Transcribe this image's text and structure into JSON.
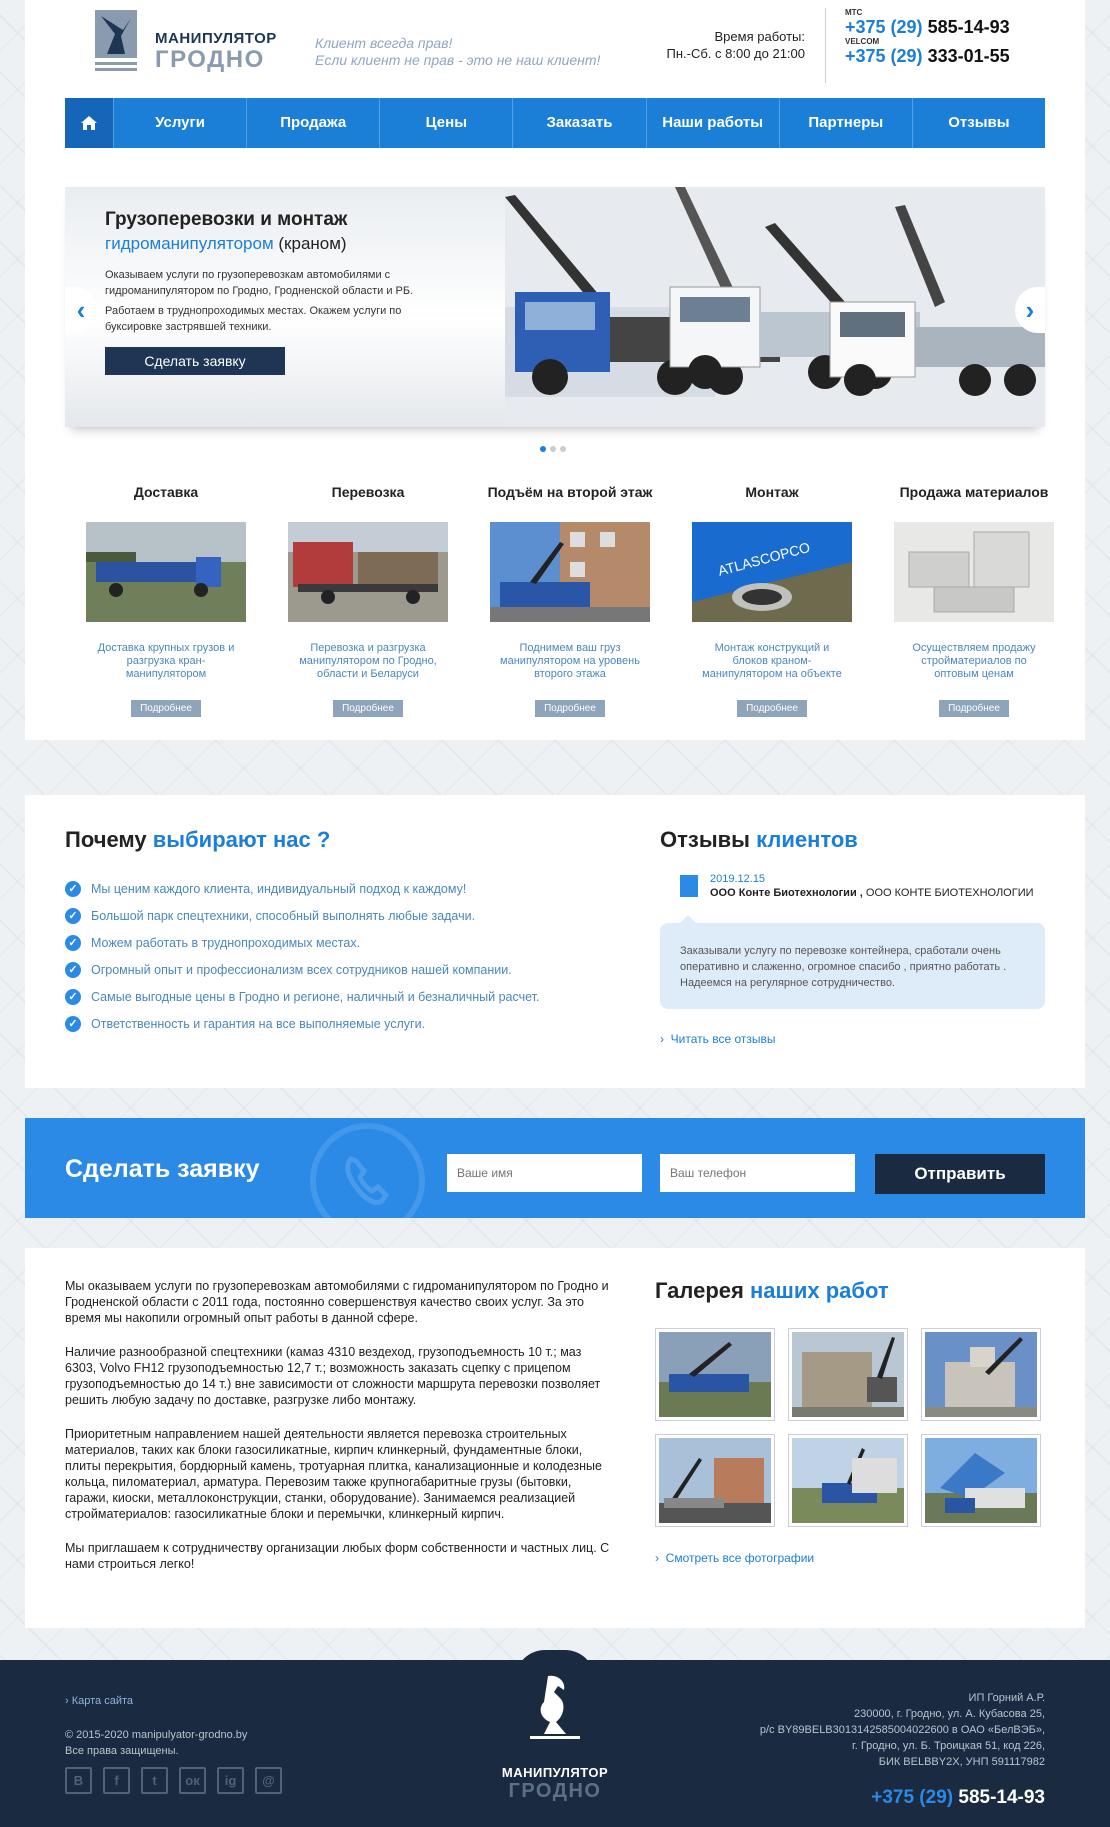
{
  "header": {
    "logo": {
      "line1": "МАНИПУЛЯТОР",
      "line2": "ГРОДНО"
    },
    "slogan": [
      "Клиент всегда прав!",
      "Если клиент не прав - это не наш клиент!"
    ],
    "worktime": {
      "label": "Время работы:",
      "hours": "Пн.-Сб. с 8:00 до 21:00"
    },
    "phones": [
      {
        "operator": "МТС",
        "code": "+375 (29)",
        "number": "585-14-93"
      },
      {
        "operator": "VELCOM",
        "code": "+375 (29)",
        "number": "333-01-55"
      }
    ]
  },
  "nav": {
    "home_icon": "home-icon",
    "items": [
      "Услуги",
      "Продажа",
      "Цены",
      "Заказать",
      "Наши работы",
      "Партнеры",
      "Отзывы"
    ]
  },
  "slider": {
    "title": "Грузоперевозки и монтаж",
    "subtitle_highlight": "гидроманипулятором",
    "subtitle_rest": "(краном)",
    "paragraph1": "Оказываем услуги по грузоперевозкам автомобилями с гидроманипулятором по Гродно, Гродненской области и РБ.",
    "paragraph2": "Работаем в труднопроходимых местах. Окажем услуги по буксировке застрявшей техники.",
    "button": "Сделать заявку",
    "prev": "‹",
    "next": "›",
    "slides_total": 3,
    "slide_active": 1
  },
  "services": [
    {
      "title": "Доставка",
      "desc": "Доставка крупных грузов и разгрузка кран-манипулятором",
      "button": "Подробнее"
    },
    {
      "title": "Перевозка",
      "desc": "Перевозка и разгрузка манипулятором по Гродно, области и Беларуси",
      "button": "Подробнее"
    },
    {
      "title": "Подъём на второй этаж",
      "desc": "Поднимем ваш груз манипулятором на уровень второго этажа",
      "button": "Подробнее"
    },
    {
      "title": "Монтаж",
      "desc": "Монтаж конструкций и блоков краном-манипулятором на объекте",
      "button": "Подробнее"
    },
    {
      "title": "Продажа материалов",
      "desc": "Осуществляем продажу стройматериалов по оптовым ценам",
      "button": "Подробнее"
    }
  ],
  "why": {
    "title_plain": "Почему",
    "title_blue": "выбирают нас ?",
    "items": [
      "Мы ценим каждого клиента, индивидуальный подход к каждому!",
      "Большой парк спецтехники, способный выполнять любые задачи.",
      "Можем работать в труднопроходимых местах.",
      "Огромный опыт и профессионализм всех сотрудников нашей компании.",
      "Самые выгодные цены в Гродно и регионе, наличный и безналичный расчет.",
      "Ответственность и гарантия на все выполняемые услуги."
    ]
  },
  "reviews": {
    "title_plain": "Отзывы",
    "title_blue": "клиентов",
    "date": "2019.12.15",
    "author_bold": "ООО Конте Биотехнологии ,",
    "author_rest": "ООО КОНТЕ БИОТЕХНОЛОГИИ",
    "text": "Заказывали услугу по перевозке контейнера, сработали очень оперативно и слаженно, огромное спасибо , приятно работать . Надеемся на регулярное сотрудничество.",
    "link": "Читать все отзывы"
  },
  "request": {
    "title": "Сделать заявку",
    "name_placeholder": "Ваше имя",
    "phone_placeholder": "Ваш телефон",
    "button": "Отправить"
  },
  "about": [
    "Мы оказываем  услуги по грузоперевозкам автомобилями с гидроманипулятором по Гродно и Гродненской области с 2011 года, постоянно совершенствуя качество своих услуг. За это время мы накопили огромный опыт работы в данной сфере.",
    "Наличие разнообразной спецтехники (камаз 4310 вездеход, грузоподъемность 10 т.; маз 6303, Volvo FH12 грузоподъемностью 12,7 т.; возможность заказать сцепку с прицепом грузоподъемностью до 14 т.) вне зависимости от сложности маршрута перевозки позволяет решить любую задачу по доставке, разгрузке либо монтажу.",
    "Приоритетным направлением нашей деятельности является перевозка строительных материалов, таких как блоки газосиликатные, кирпич клинкерный, фундаментные блоки, плиты перекрытия, бордюрный камень, тротуарная плитка, канализационные и колодезные кольца, пиломатериал, арматура. Перевозим также крупногабаритные грузы (бытовки, гаражи, киоски, металлоконструкции, станки, оборудование). Занимаемся реализацией стройматериалов: газосиликатные блоки и перемычки, клинкерный кирпич.",
    "Мы приглашаем к сотрудничеству организации любых форм собственности и частных лиц. С нами строиться легко!"
  ],
  "gallery": {
    "title_plain": "Галерея",
    "title_blue": "наших работ",
    "link": "Смотреть все фотографии"
  },
  "footer": {
    "sitemap": "Карта сайта",
    "copyright": "© 2015-2020 manipulyator-grodno.by",
    "rights": "Все права защищены.",
    "socials": [
      "В",
      "f",
      "t",
      "ок",
      "ig",
      "@"
    ],
    "logo_line1": "МАНИПУЛЯТОР",
    "logo_line2": "ГРОДНО",
    "info": [
      "ИП Горний А.Р.",
      "230000, г. Гродно, ул. А. Кубасова 25,",
      "р/с BY89BELB3013142585004022600 в ОАО «БелВЭБ»,",
      "г. Гродно, ул. Б. Троицкая 51, код 226,",
      "БИК BELBBY2X, УНП 591117982"
    ],
    "phone_code": "+375 (29)",
    "phone_number": "585-14-93"
  }
}
